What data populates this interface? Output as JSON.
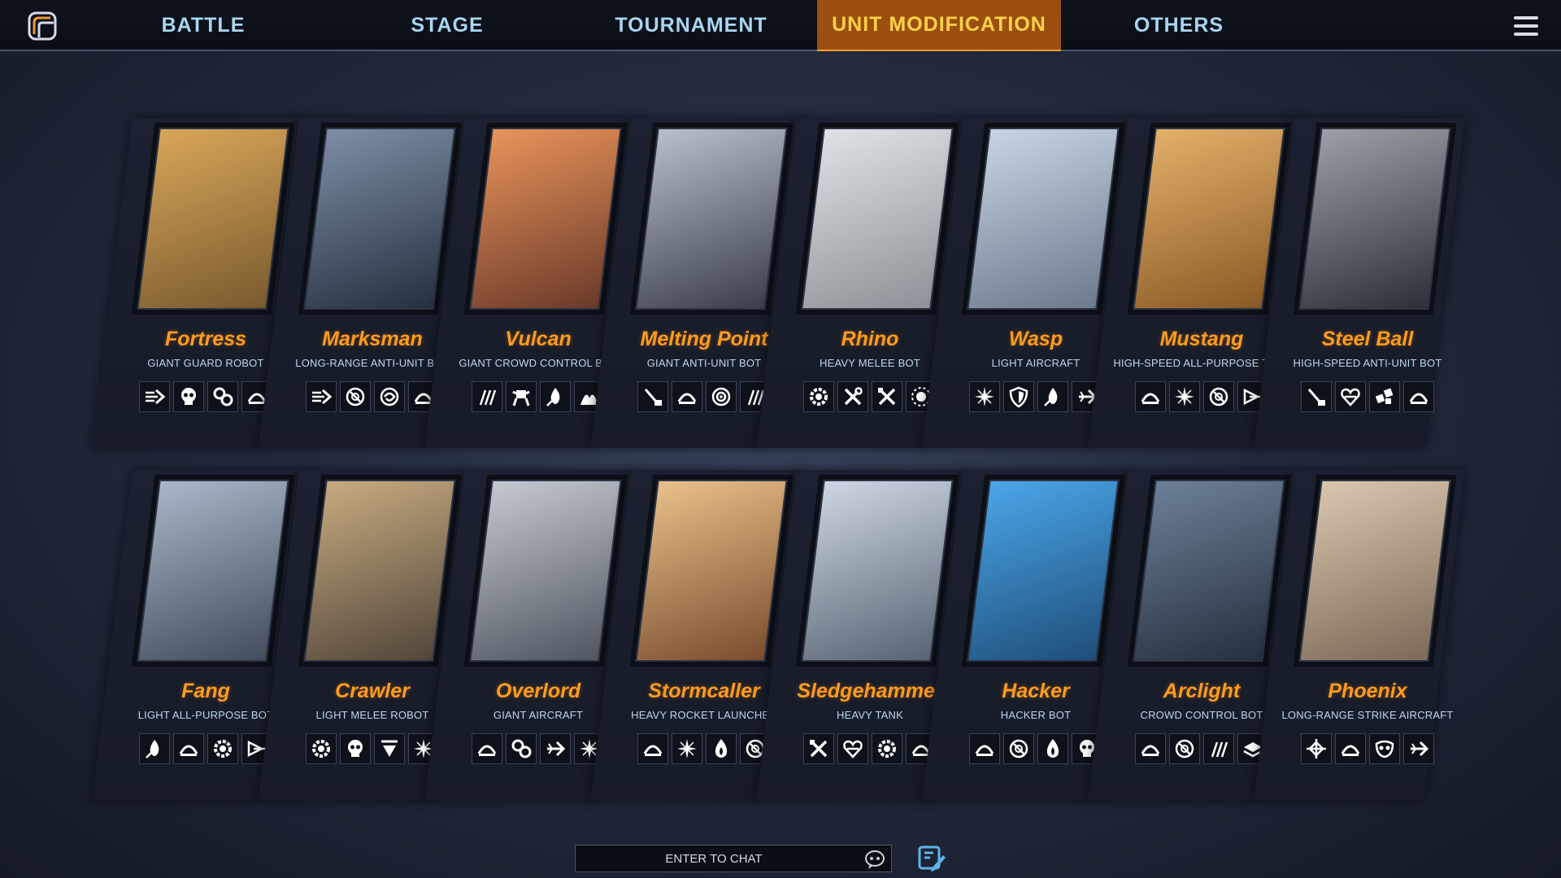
{
  "nav": {
    "logo_icon": "game-logo-icon",
    "tabs": [
      {
        "label": "BATTLE",
        "active": false
      },
      {
        "label": "STAGE",
        "active": false
      },
      {
        "label": "TOURNAMENT",
        "active": false
      },
      {
        "label": "UNIT MODIFICATION",
        "active": true
      },
      {
        "label": "OTHERS",
        "active": false
      }
    ],
    "menu_icon": "hamburger-menu-icon"
  },
  "units": [
    {
      "name": "Fortress",
      "role": "Giant Guard Robot",
      "art": [
        "#d8a659",
        "#7a5a2f"
      ],
      "abilities": [
        "dash-icon",
        "skull-icon",
        "gears-icon",
        "shield-arc-icon"
      ]
    },
    {
      "name": "Marksman",
      "role": "Long-Range Anti-Unit Bot",
      "art": [
        "#7d8ea6",
        "#27303f"
      ],
      "abilities": [
        "dash-icon",
        "no-target-icon",
        "swirl-icon",
        "shield-arc-icon"
      ]
    },
    {
      "name": "Vulcan",
      "role": "Giant Crowd Control Bot",
      "art": [
        "#e8935a",
        "#6b3a2a"
      ],
      "abilities": [
        "claw-icon",
        "mech-icon",
        "flame-icon",
        "fire-wave-icon"
      ]
    },
    {
      "name": "Melting Point",
      "role": "Giant Anti-Unit Bot",
      "art": [
        "#b8bfca",
        "#3a3f4a"
      ],
      "abilities": [
        "laser-icon",
        "shield-arc-icon",
        "target-icon",
        "claw-icon"
      ]
    },
    {
      "name": "Rhino",
      "role": "Heavy Melee Bot",
      "art": [
        "#dfe2e6",
        "#8e9197"
      ],
      "abilities": [
        "gear-icon",
        "wrench-icon",
        "tools-icon",
        "burst-icon"
      ]
    },
    {
      "name": "Wasp",
      "role": "Light Aircraft",
      "art": [
        "#c6d4e3",
        "#6c7a8c"
      ],
      "abilities": [
        "spark-icon",
        "shield-icon",
        "flame-icon",
        "jet-icon"
      ]
    },
    {
      "name": "Mustang",
      "role": "High-Speed All-Purpose Tank",
      "art": [
        "#e3b06a",
        "#8a5a25"
      ],
      "abilities": [
        "shield-arc-icon",
        "spark-icon",
        "no-target-icon",
        "arrow-icon"
      ]
    },
    {
      "name": "Steel Ball",
      "role": "High-Speed Anti-Unit Bot",
      "art": [
        "#9ba0a8",
        "#2d3038"
      ],
      "abilities": [
        "laser-icon",
        "heart-icon",
        "blocks-icon",
        "shield-arc-icon"
      ]
    },
    {
      "name": "Fang",
      "role": "Light All-Purpose Bot",
      "art": [
        "#a9b7c8",
        "#434d5c"
      ],
      "abilities": [
        "flame-icon",
        "shield-arc-icon",
        "gear-icon",
        "arrow-icon"
      ]
    },
    {
      "name": "Crawler",
      "role": "Light Melee Robot",
      "art": [
        "#c8aa80",
        "#51473a"
      ],
      "abilities": [
        "gear-icon",
        "skull-icon",
        "down-arrow-icon",
        "spark-icon"
      ]
    },
    {
      "name": "Overlord",
      "role": "Giant Aircraft",
      "art": [
        "#c4c9d1",
        "#505660"
      ],
      "abilities": [
        "shield-arc-icon",
        "gears-icon",
        "jet-icon",
        "spark-icon"
      ]
    },
    {
      "name": "Stormcaller",
      "role": "Heavy Rocket Launcher",
      "art": [
        "#e9c08a",
        "#7b4d2e"
      ],
      "abilities": [
        "shield-arc-icon",
        "spark-icon",
        "fire-icon",
        "no-target-icon"
      ]
    },
    {
      "name": "Sledgehammer",
      "role": "Heavy Tank",
      "art": [
        "#cdd6e2",
        "#5a6472"
      ],
      "abilities": [
        "tools-icon",
        "heart-icon",
        "gear-icon",
        "shield-arc-icon"
      ]
    },
    {
      "name": "Hacker",
      "role": "Hacker Bot",
      "art": [
        "#4aa6e8",
        "#1f4e7a"
      ],
      "abilities": [
        "shield-arc-icon",
        "no-target-icon",
        "fire-icon",
        "skull-icon"
      ]
    },
    {
      "name": "Arclight",
      "role": "Crowd Control Bot",
      "art": [
        "#6d8099",
        "#26303d"
      ],
      "abilities": [
        "shield-arc-icon",
        "no-target-icon",
        "claw-icon",
        "layers-icon"
      ]
    },
    {
      "name": "Phoenix",
      "role": "Long-Range Strike Aircraft",
      "art": [
        "#d9c6ae",
        "#7d6a57"
      ],
      "abilities": [
        "crosshair-icon",
        "shield-arc-icon",
        "mask-icon",
        "jet-icon"
      ]
    }
  ],
  "chat": {
    "placeholder": "ENTER TO CHAT",
    "emoji_icon": "chat-bubble-icon",
    "send_icon": "edit-send-icon"
  }
}
